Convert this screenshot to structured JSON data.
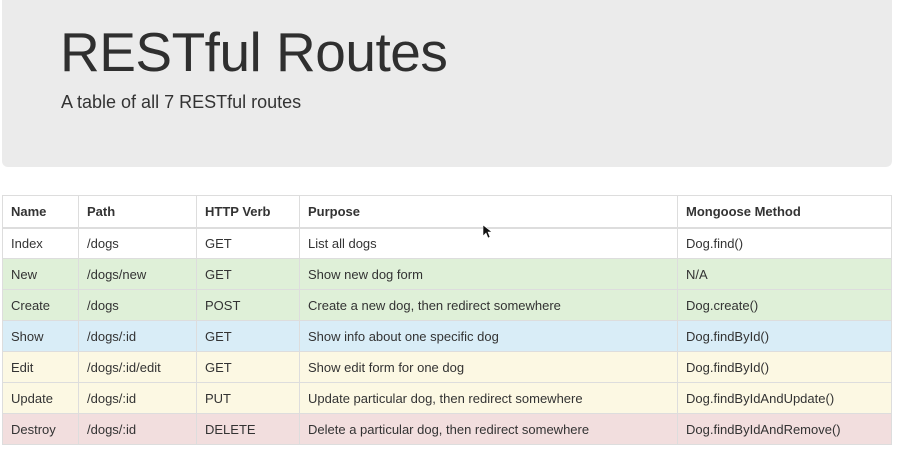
{
  "header": {
    "title": "RESTful Routes",
    "subtitle": "A table of all 7 RESTful routes"
  },
  "table": {
    "columns": [
      "Name",
      "Path",
      "HTTP Verb",
      "Purpose",
      "Mongoose Method"
    ],
    "rows": [
      {
        "status": "default",
        "cells": [
          "Index",
          "/dogs",
          "GET",
          "List all dogs",
          "Dog.find()"
        ]
      },
      {
        "status": "success",
        "cells": [
          "New",
          "/dogs/new",
          "GET",
          "Show new dog form",
          "N/A"
        ]
      },
      {
        "status": "success",
        "cells": [
          "Create",
          "/dogs",
          "POST",
          "Create a new dog, then redirect somewhere",
          "Dog.create()"
        ]
      },
      {
        "status": "info",
        "cells": [
          "Show",
          "/dogs/:id",
          "GET",
          "Show info about one specific dog",
          "Dog.findById()"
        ]
      },
      {
        "status": "warning",
        "cells": [
          "Edit",
          "/dogs/:id/edit",
          "GET",
          "Show edit form for one dog",
          "Dog.findById()"
        ]
      },
      {
        "status": "warning",
        "cells": [
          "Update",
          "/dogs/:id",
          "PUT",
          "Update particular dog, then redirect somewhere",
          "Dog.findByIdAndUpdate()"
        ]
      },
      {
        "status": "danger",
        "cells": [
          "Destroy",
          "/dogs/:id",
          "DELETE",
          "Delete a particular dog, then redirect somewhere",
          "Dog.findByIdAndRemove()"
        ]
      }
    ]
  },
  "colors": {
    "success": "#dff0d8",
    "info": "#d9edf7",
    "warning": "#fcf8e3",
    "danger": "#f2dede",
    "jumbotron": "#ebebeb"
  }
}
